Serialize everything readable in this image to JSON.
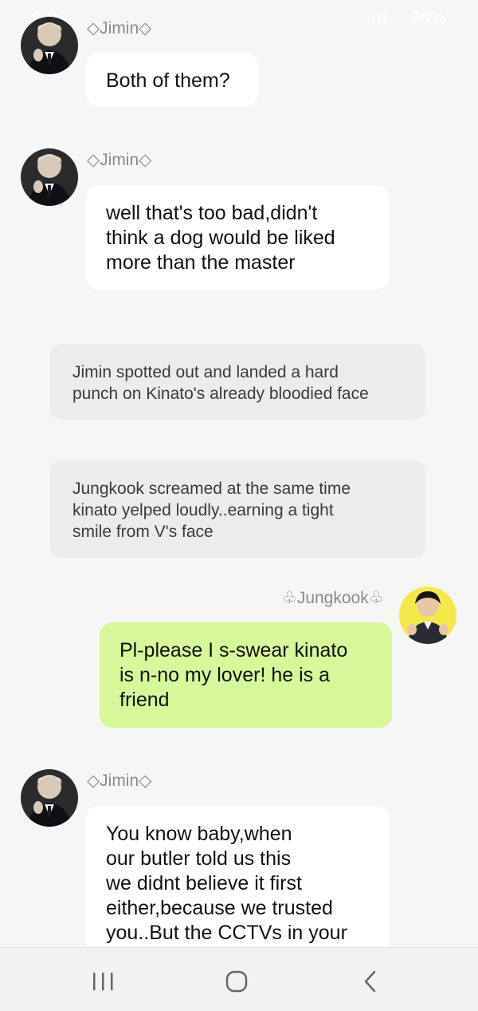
{
  "status_bar": {
    "time": "6:23",
    "battery": "59%"
  },
  "messages": [
    {
      "sender": "◇Jimin◇",
      "text": "Both of them?"
    },
    {
      "sender": "◇Jimin◇",
      "text": "well that's too bad,didn't\nthink a dog would be liked\nmore than the master"
    },
    {
      "narration": "Jimin spotted out and landed a hard\npunch on Kinato's already bloodied face"
    },
    {
      "narration": "Jungkook screamed at the same time\nkinato yelped loudly..earning a tight\nsmile from V's face"
    },
    {
      "sender": "♧Jungkook♧",
      "text": "Pl-please I s-swear kinato\nis n-no my lover! he is a\nfriend"
    },
    {
      "sender": "◇Jimin◇",
      "text": "You know baby,when\nour butler told us this\nwe didnt believe it first\neither,because we trusted\nyou..But the CCTVs in your"
    }
  ],
  "nav": {
    "recent_icon": "recent-apps-icon",
    "home_icon": "home-icon",
    "back_icon": "back-icon"
  },
  "colors": {
    "background": "#f6f6f6",
    "incoming_bubble": "#ffffff",
    "outgoing_bubble": "#d6f79a",
    "narration_box": "#ececec",
    "name_text": "#8a8a8a",
    "jungkook_avatar_bg": "#f5e94a"
  }
}
